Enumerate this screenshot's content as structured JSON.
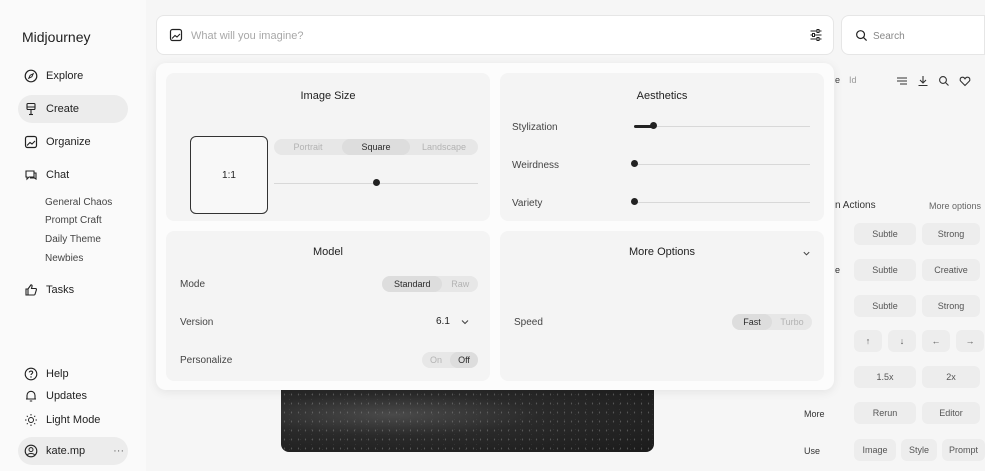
{
  "app": {
    "logo": "Midjourney"
  },
  "sidebar": {
    "items": [
      {
        "label": "Explore"
      },
      {
        "label": "Create"
      },
      {
        "label": "Organize"
      },
      {
        "label": "Chat"
      },
      {
        "label": "Tasks"
      }
    ],
    "chat_channels": [
      "General Chaos",
      "Prompt Craft",
      "Daily Theme",
      "Newbies"
    ],
    "bottom": [
      {
        "label": "Help"
      },
      {
        "label": "Updates"
      },
      {
        "label": "Light Mode"
      }
    ],
    "user": {
      "name": "kate.mp",
      "more": "···"
    }
  },
  "prompt": {
    "placeholder": "What will you imagine?"
  },
  "search": {
    "placeholder": "Search"
  },
  "settings": {
    "image_size": {
      "title": "Image Size",
      "ratio": "1:1",
      "options": [
        "Portrait",
        "Square",
        "Landscape"
      ],
      "selected": "Square",
      "slider_value": 0.5
    },
    "aesthetics": {
      "title": "Aesthetics",
      "sliders": [
        {
          "label": "Stylization",
          "value": 0.11
        },
        {
          "label": "Weirdness",
          "value": 0.0
        },
        {
          "label": "Variety",
          "value": 0.0
        }
      ]
    },
    "model": {
      "title": "Model",
      "mode_label": "Mode",
      "mode_options": [
        "Standard",
        "Raw"
      ],
      "mode_selected": "Standard",
      "version_label": "Version",
      "version_value": "6.1",
      "personalize_label": "Personalize",
      "personalize_options": [
        "On",
        "Off"
      ],
      "personalize_selected": "Off"
    },
    "more_options": {
      "title": "More Options",
      "speed_label": "Speed",
      "speed_options": [
        "Fast",
        "Turbo"
      ],
      "speed_selected": "Fast"
    }
  },
  "right_panel": {
    "partial_label_1": "e",
    "partial_label_2": "Id",
    "actions_header": "n Actions",
    "more_options_header": "More options",
    "row1": [
      "Subtle",
      "Strong"
    ],
    "row2_partial": "e",
    "row2": [
      "Subtle",
      "Creative"
    ],
    "row3": [
      "Subtle",
      "Strong"
    ],
    "arrows": [
      "↑",
      "↓",
      "←",
      "→"
    ],
    "zoom": [
      "1.5x",
      "2x"
    ],
    "more_label": "More",
    "more_buttons": [
      "Rerun",
      "Editor"
    ],
    "use_label": "Use",
    "use_buttons": [
      "Image",
      "Style",
      "Prompt"
    ]
  }
}
